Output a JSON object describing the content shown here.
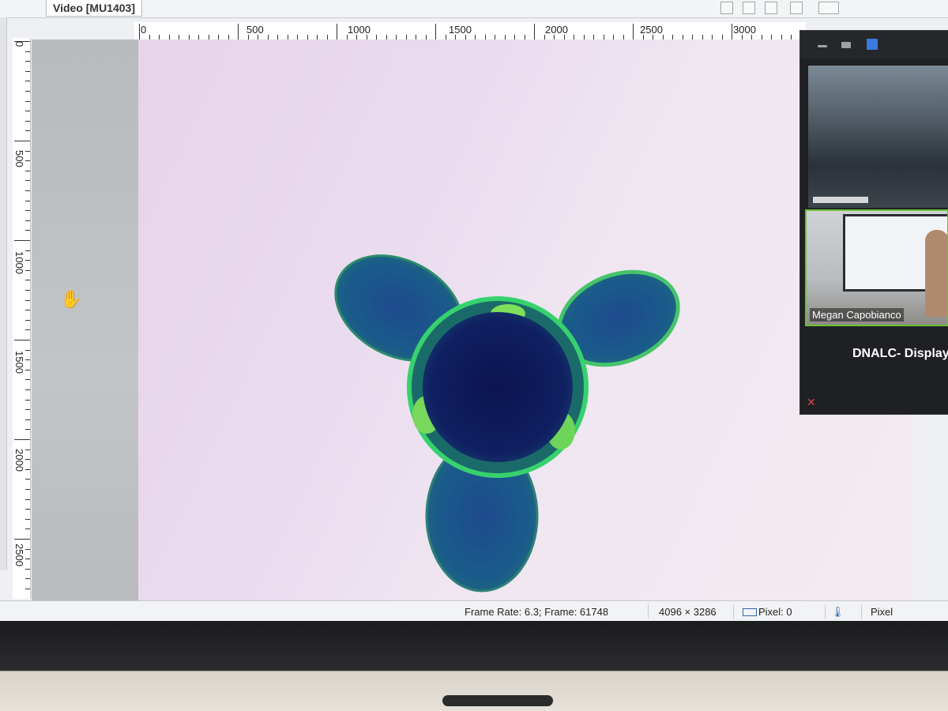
{
  "tab": {
    "title": "Video [MU1403]"
  },
  "ruler": {
    "h_labels": [
      "0",
      "500",
      "1000",
      "1500",
      "2000",
      "2500",
      "3000"
    ],
    "v_labels": [
      "0",
      "500",
      "1000",
      "1500",
      "2000",
      "2500"
    ]
  },
  "status": {
    "frame": "Frame Rate: 6.3; Frame: 61748",
    "resolution": "4096 × 3286",
    "pixel": "Pixel: 0",
    "unit": "Pixel"
  },
  "meeting": {
    "participant_name": "Megan Capobianco",
    "display_label": "DNALC- Display"
  },
  "icons": {
    "cursor": "hand-cursor-icon",
    "mic": "microphone-muted-icon",
    "ruler": "ruler-icon",
    "thermometer": "thermometer-icon"
  },
  "colors": {
    "specimen_dark": "#0b1a5a",
    "specimen_mid": "#1c4f8f",
    "specimen_rim": "#37d16d",
    "background": "#efe6f1",
    "active_speaker": "#67c234"
  }
}
